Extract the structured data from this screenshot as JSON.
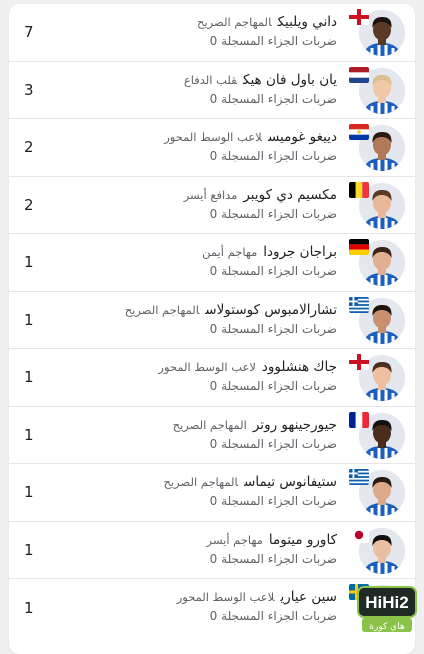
{
  "stat_label": "ضربات الجزاء المسجلة",
  "players": [
    {
      "name": "داني ويلبيك",
      "position": "المهاجم الصريح",
      "value": "0",
      "count": "7",
      "flag": "england",
      "skin": "#5a3a26",
      "hair": "#1b1410"
    },
    {
      "name": "يان باول فان هيك",
      "position": "قلب الدفاع",
      "value": "0",
      "count": "3",
      "flag": "netherlands",
      "skin": "#f0c8a8",
      "hair": "#d8c090"
    },
    {
      "name": "دييغو غوميس",
      "position": "لاعب الوسط المحور",
      "value": "0",
      "count": "2",
      "flag": "paraguay",
      "skin": "#b07a58",
      "hair": "#2a1a12"
    },
    {
      "name": "مكسيم دي كويبر",
      "position": "مدافع أيسر",
      "value": "0",
      "count": "2",
      "flag": "belgium",
      "skin": "#e8b898",
      "hair": "#5a3a22"
    },
    {
      "name": "براجان جرودا",
      "position": "مهاجم أيمن",
      "value": "0",
      "count": "1",
      "flag": "germany",
      "skin": "#e0b090",
      "hair": "#3a2418"
    },
    {
      "name": "تشارالامبوس كوستولاس",
      "position": "المهاجم الصريح",
      "value": "0",
      "count": "1",
      "flag": "greece",
      "skin": "#c89070",
      "hair": "#1e140e"
    },
    {
      "name": "جاك هنشلوود",
      "position": "لاعب الوسط المحور",
      "value": "0",
      "count": "1",
      "flag": "england",
      "skin": "#eebfa0",
      "hair": "#4a3020"
    },
    {
      "name": "جيورجينهو روتر",
      "position": "المهاجم الصريح",
      "value": "0",
      "count": "1",
      "flag": "france",
      "skin": "#4a2c1c",
      "hair": "#141010"
    },
    {
      "name": "ستيفانوس تيماس",
      "position": "المهاجم الصريح",
      "value": "0",
      "count": "1",
      "flag": "greece",
      "skin": "#dcaa88",
      "hair": "#2a1c14"
    },
    {
      "name": "كاورو ميتوما",
      "position": "مهاجم أيسر",
      "value": "0",
      "count": "1",
      "flag": "japan",
      "skin": "#e8c0a0",
      "hair": "#121010"
    },
    {
      "name": "سين عياري",
      "position": "لاعب الوسط المحور",
      "value": "0",
      "count": "1",
      "flag": "sweden",
      "skin": "#d0a080",
      "hair": "#1a1410"
    }
  ],
  "logo": {
    "brand": "HiHi2",
    "subtitle": "هاي كورة"
  }
}
